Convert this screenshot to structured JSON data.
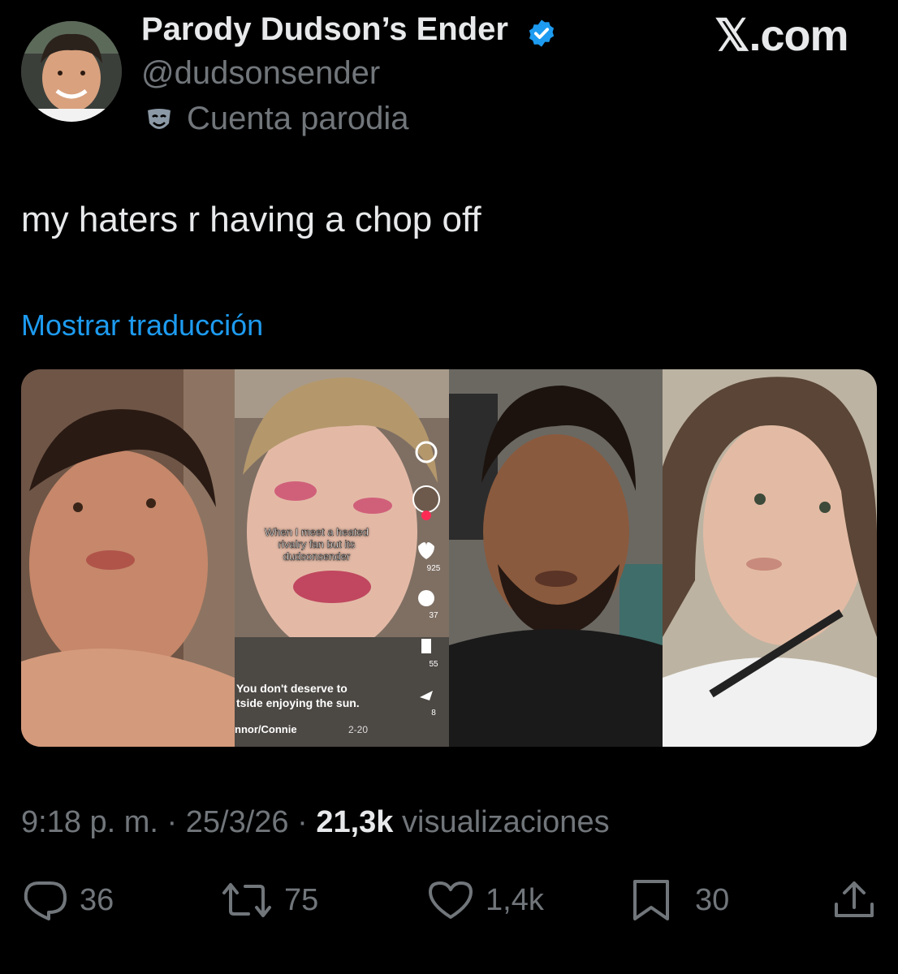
{
  "author": {
    "display_name": "Parody Dudson’s Ender",
    "handle": "@dudsonsender",
    "parody_label": "Cuenta parodia",
    "verified": true
  },
  "brand": "𝕏.com",
  "tweet": {
    "text": "my haters r having a chop off",
    "translate_label": "Mostrar traducción"
  },
  "media": {
    "overlay": {
      "sticker_text": "When I meet a heated rivalry fan but its dudsonsender",
      "caption": "You don't deserve to\ntside enjoying the sun.",
      "author_line": "nnor/Connie",
      "date": "2-20",
      "likes": "925",
      "comments": "37",
      "saves": "55",
      "shares": "8"
    }
  },
  "meta": {
    "time": "9:18 p. m.",
    "date": "25/3/26",
    "separator": "·",
    "views_count": "21,3k",
    "views_label": "visualizaciones"
  },
  "actions": {
    "replies": "36",
    "reposts": "75",
    "likes": "1,4k",
    "bookmarks": "30"
  },
  "colors": {
    "background": "#000000",
    "text": "#e7e9ea",
    "muted": "#71767b",
    "link": "#1d9bf0",
    "verified": "#1d9bf0"
  }
}
